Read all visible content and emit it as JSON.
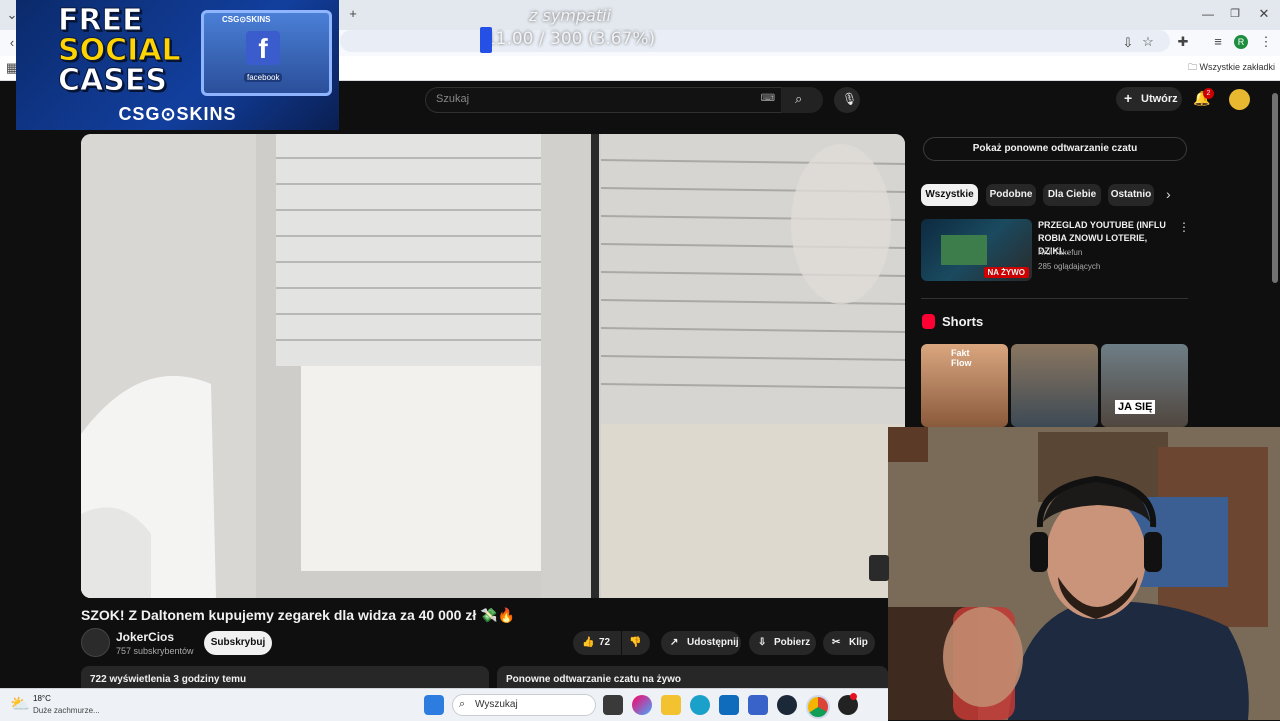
{
  "overlay": {
    "promo_lines": [
      "FREE",
      "SOCIAL",
      "CASES"
    ],
    "promo_brand": "CSG⊙SKINS",
    "promo_crate_brand": "CSG⊙SKINS",
    "promo_crate_label": "facebook",
    "goal_label": "z sympatii",
    "goal_value": "11.00 / 300 (3.67%)",
    "goal_progress": 0.0367,
    "goal_fill_color": "#2550e6"
  },
  "browser": {
    "new_tab": "+",
    "bookmarks_label": "Wszystkie zakładki",
    "profile_initial": "R"
  },
  "youtube": {
    "search_placeholder": "Szukaj",
    "create_label": "Utwórz",
    "notifications_count": "2"
  },
  "video": {
    "title": "SZOK! Z Daltonem kupujemy zegarek dla widza za 40 000 zł 💸🔥",
    "channel_name": "JokerCios",
    "subscribers": "757 subskrybentów",
    "subscribe_label": "Subskrybuj",
    "likes": "72",
    "share_label": "Udostępnij",
    "download_label": "Pobierz",
    "clip_label": "Klip",
    "views": "722 wyświetlenia  3 godziny temu",
    "chat_replay_label": "Ponowne odtwarzanie czatu na żywo"
  },
  "sidebar": {
    "chat_replay_button": "Pokaż ponowne odtwarzanie czatu",
    "chips": [
      "Wszystkie",
      "Podobne",
      "Dla Ciebie",
      "Ostatnio"
    ],
    "rec_title": "PRZEGLAD YOUTUBE (INFLU ROBIA ZNOWU LOTERIE, DZIKI...",
    "rec_channel": "Krul Takefun",
    "rec_viewers": "285 oglądających",
    "rec_live_badge": "NA ŻYWO",
    "shorts_heading": "Shorts",
    "short1_text": "Fakt Flow",
    "short3_text": "JA SIĘ"
  },
  "taskbar": {
    "weather_temp": "18°C",
    "weather_desc": "Duże zachmurze...",
    "search_label": "Wyszukaj"
  },
  "colors": {
    "yt_background": "#0f0f0f",
    "live_red": "#cc0000",
    "chip_active": "#f1f1f1"
  }
}
